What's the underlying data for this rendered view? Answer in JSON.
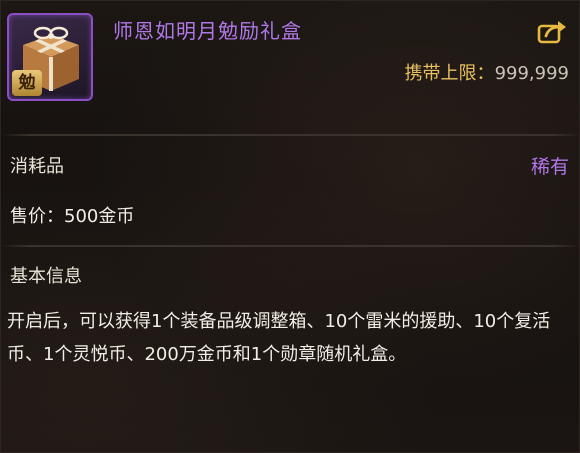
{
  "item": {
    "name": "师恩如明月勉励礼盒",
    "icon": "gift-box-icon",
    "badge": "勉",
    "carry_limit_label": "携带上限：",
    "carry_limit_value": "999,999"
  },
  "meta": {
    "category": "消耗品",
    "rarity": "稀有",
    "price": "售价：500金币"
  },
  "info": {
    "section_title": "基本信息",
    "description": "开启后，可以获得1个装备品级调整箱、10个雷米的援助、10个复活币、1个灵悦币、200万金币和1个勋章随机礼盒。"
  },
  "colors": {
    "rarity_purple": "#b077e8",
    "gold_label": "#e8c060",
    "background": "#1a1512"
  },
  "icons": {
    "share": "share-export-icon"
  }
}
